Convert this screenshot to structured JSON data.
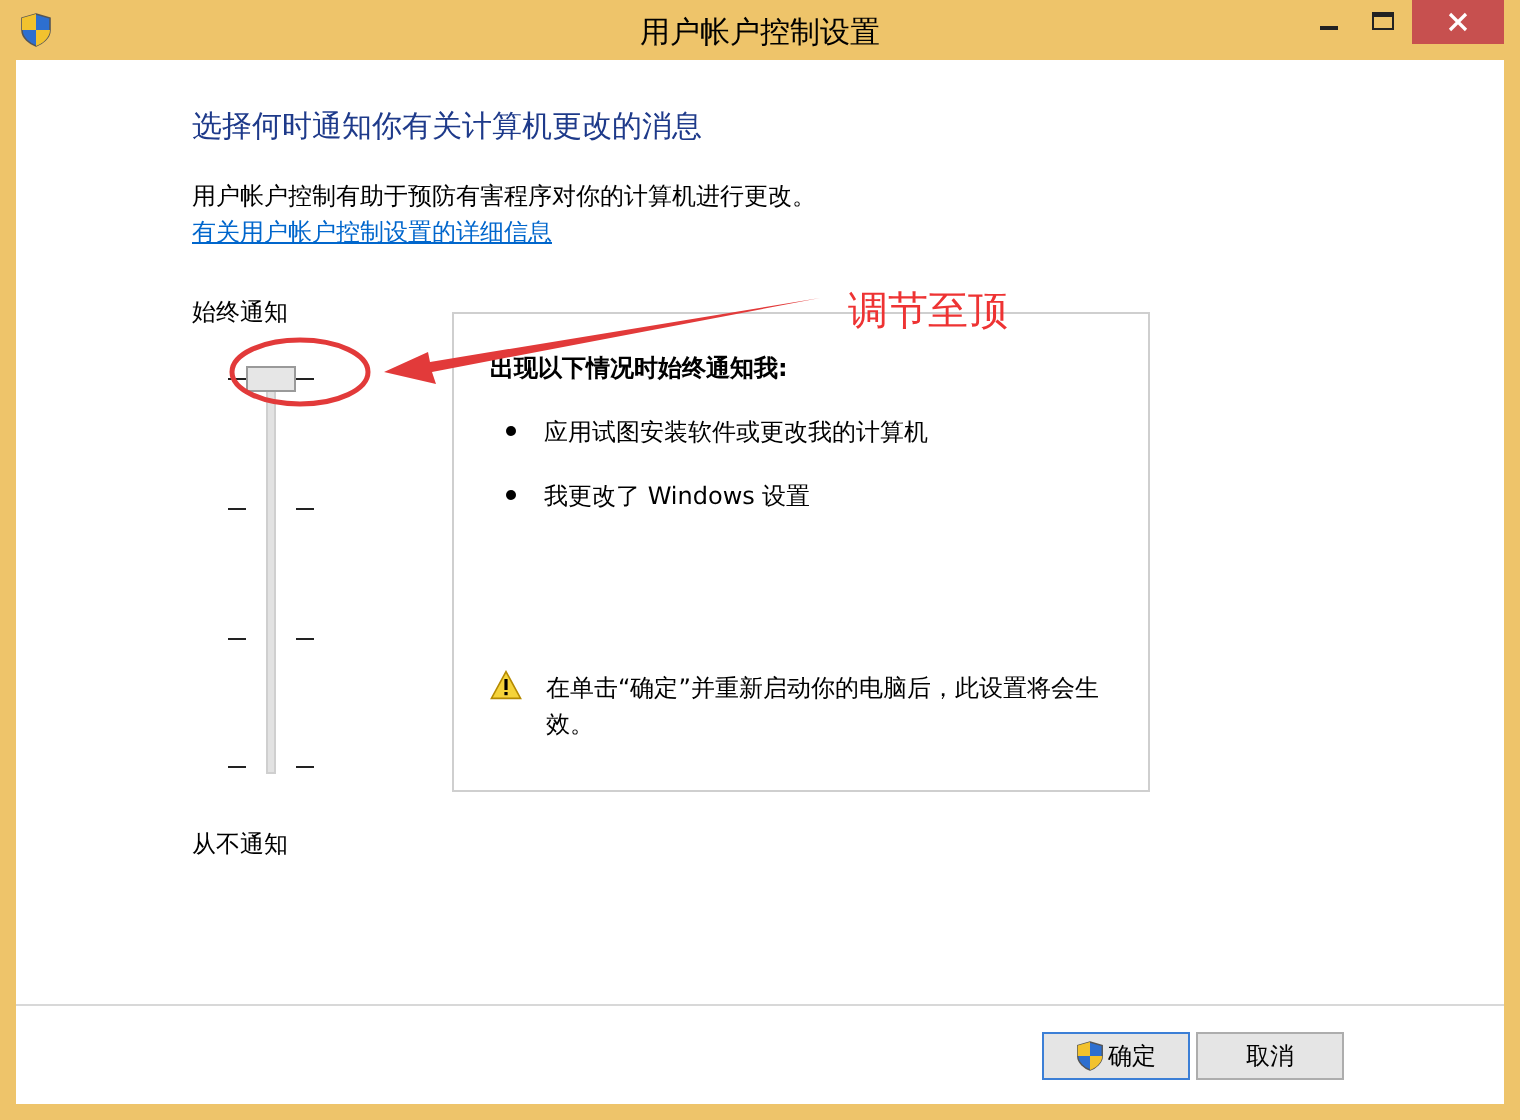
{
  "window": {
    "title": "用户帐户控制设置"
  },
  "heading": "选择何时通知你有关计算机更改的消息",
  "description": "用户帐户控制有助于预防有害程序对你的计算机进行更改。",
  "link": "有关用户帐户控制设置的详细信息",
  "slider": {
    "top_label": "始终通知",
    "bottom_label": "从不通知",
    "level": 1
  },
  "info": {
    "title": "出现以下情况时始终通知我:",
    "bullets": [
      "应用试图安装软件或更改我的计算机",
      "我更改了 Windows 设置"
    ],
    "note": "在单击“确定”并重新启动你的电脑后，此设置将会生效。"
  },
  "annotation": {
    "text": "调节至顶"
  },
  "buttons": [
    {
      "label": "确定",
      "kind": "shield"
    },
    {
      "label": "取消",
      "kind": "plain"
    }
  ]
}
